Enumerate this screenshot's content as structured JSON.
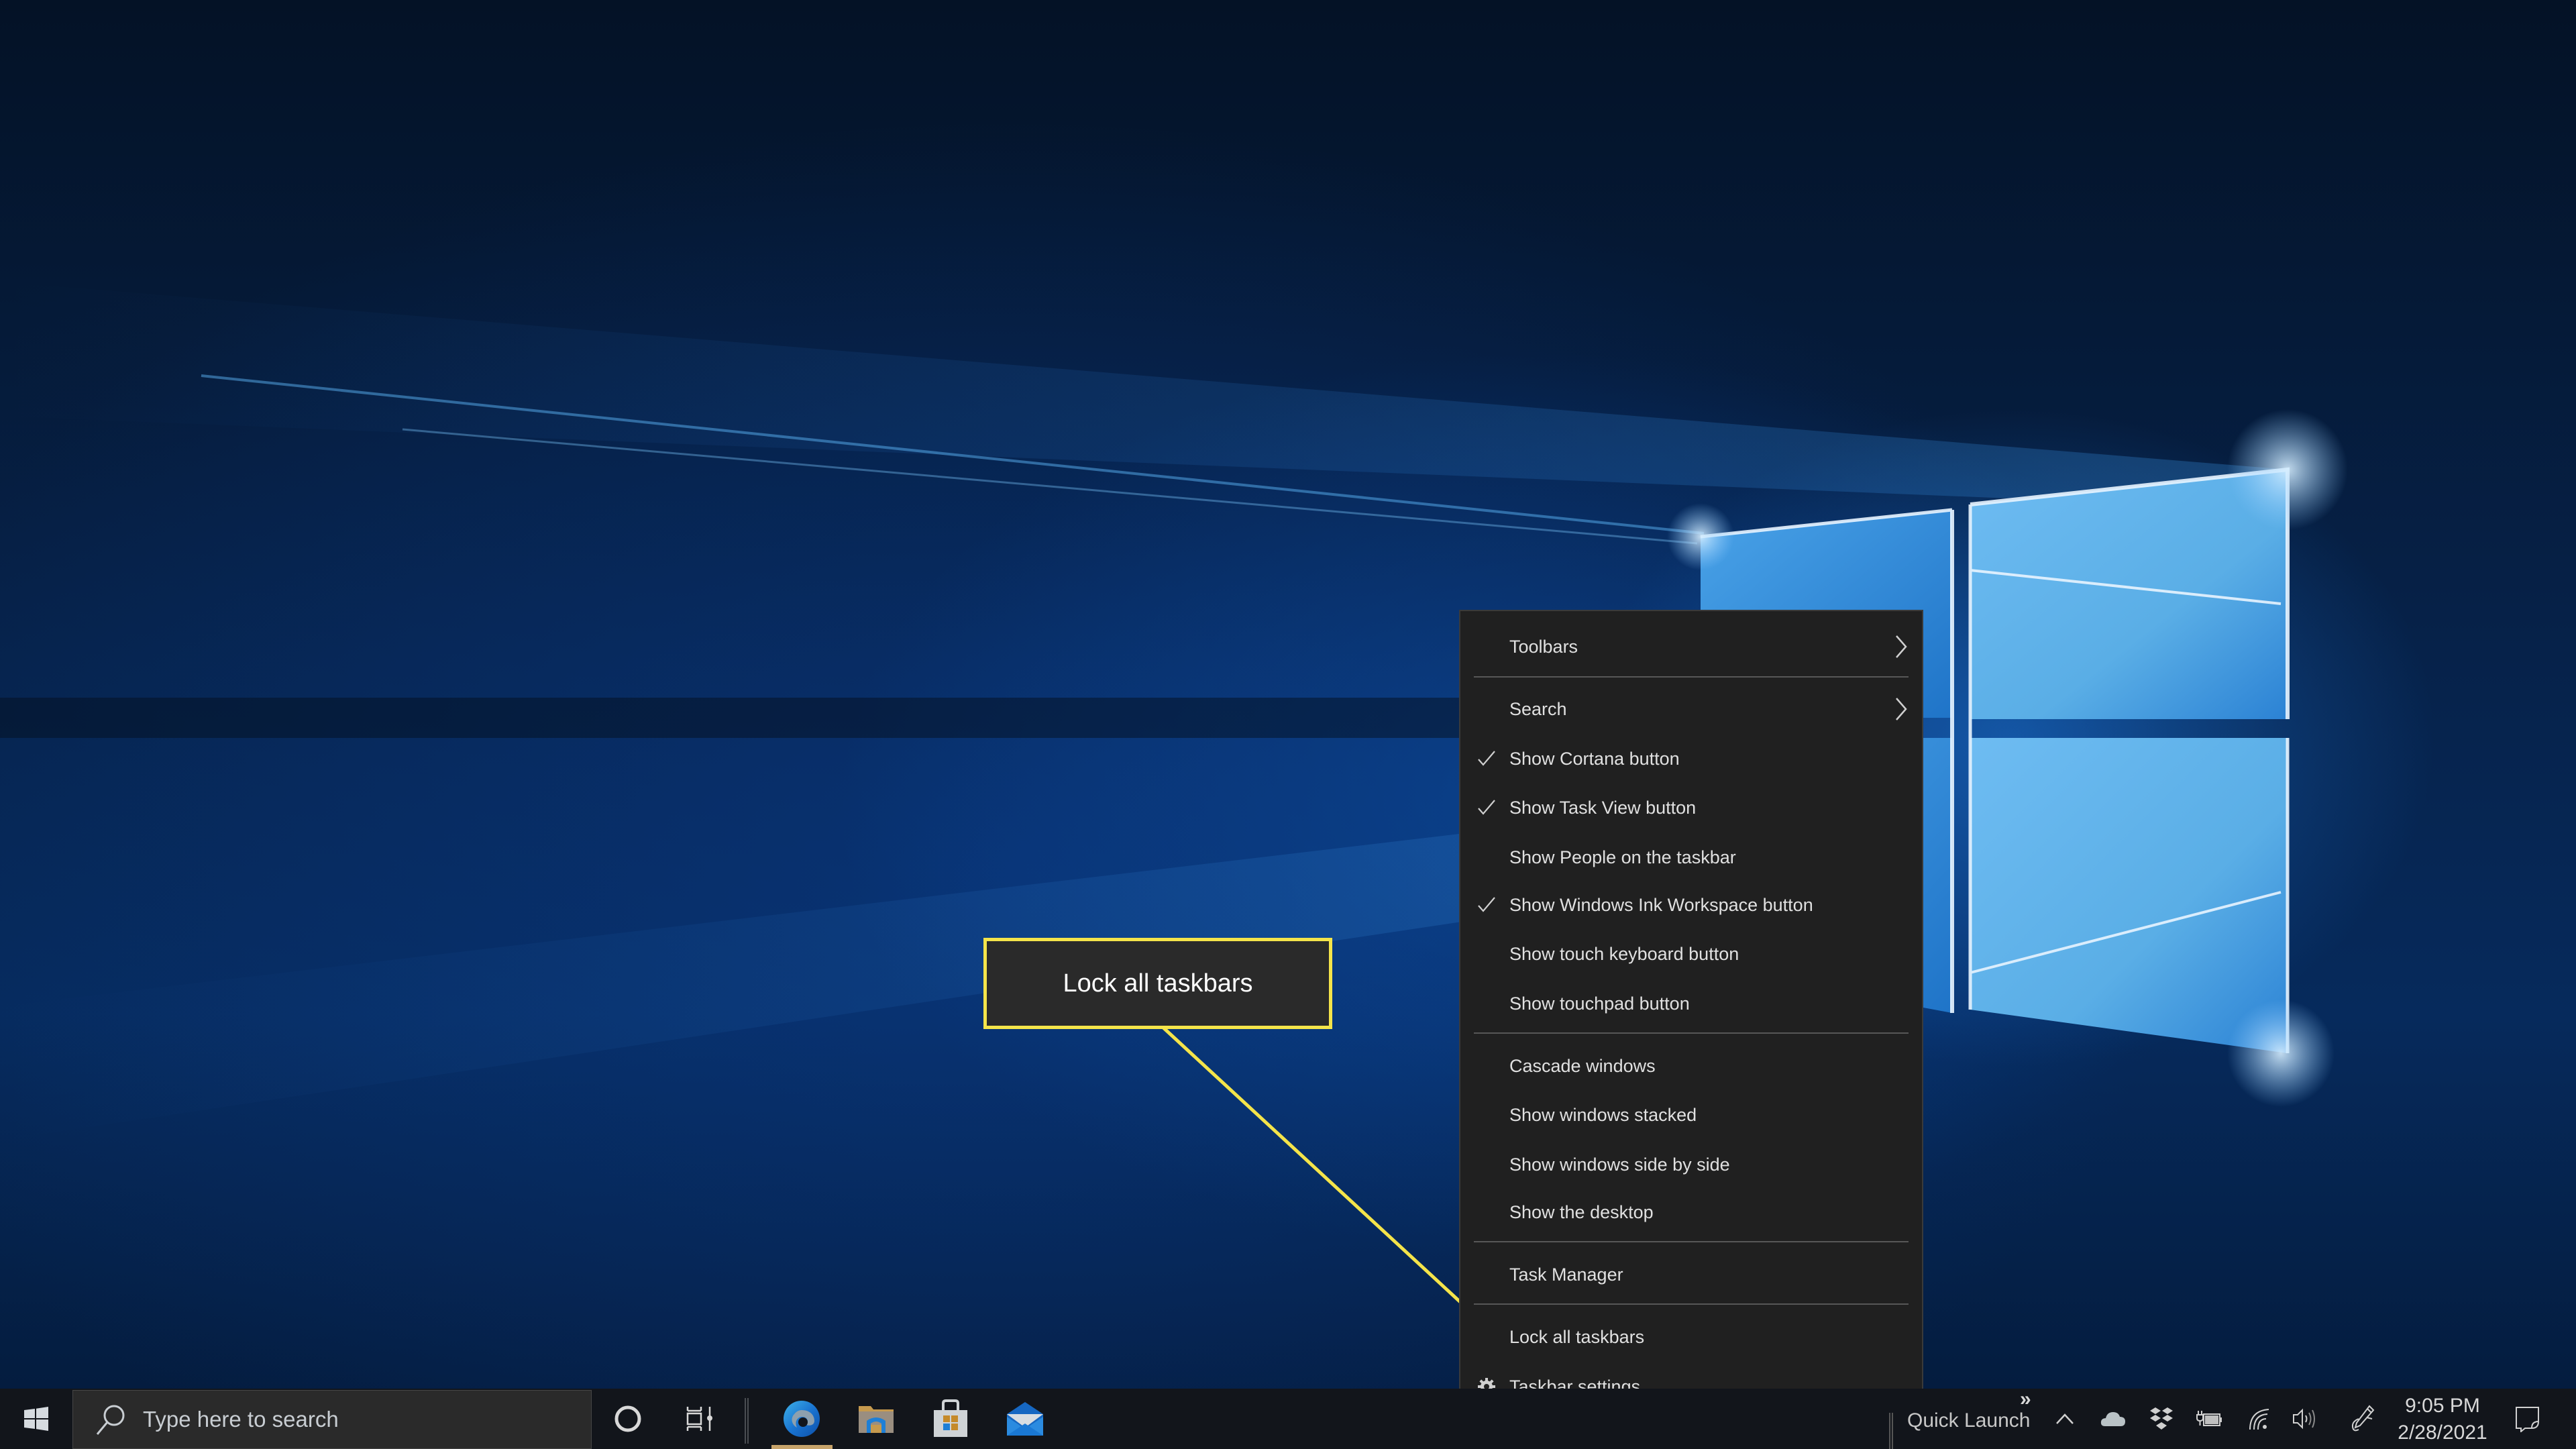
{
  "desktop": {
    "wallpaper": "windows-10-hero-light",
    "colors": {
      "wallpaper_dark": "#041226",
      "wallpaper_light": "#5fb4f0",
      "callout_yellow": "#f4e44a"
    }
  },
  "callout": {
    "label": "Lock all taskbars"
  },
  "context_menu": {
    "items": [
      {
        "label": "Toolbars",
        "checked": false,
        "submenu": true
      },
      {
        "label": "Search",
        "checked": false,
        "submenu": true
      },
      {
        "label": "Show Cortana button",
        "checked": true,
        "submenu": false
      },
      {
        "label": "Show Task View button",
        "checked": true,
        "submenu": false
      },
      {
        "label": "Show People on the taskbar",
        "checked": false,
        "submenu": false
      },
      {
        "label": "Show Windows Ink Workspace button",
        "checked": true,
        "submenu": false
      },
      {
        "label": "Show touch keyboard button",
        "checked": false,
        "submenu": false
      },
      {
        "label": "Show touchpad button",
        "checked": false,
        "submenu": false
      },
      {
        "label": "Cascade windows",
        "checked": false,
        "submenu": false
      },
      {
        "label": "Show windows stacked",
        "checked": false,
        "submenu": false
      },
      {
        "label": "Show windows side by side",
        "checked": false,
        "submenu": false
      },
      {
        "label": "Show the desktop",
        "checked": false,
        "submenu": false
      },
      {
        "label": "Task Manager",
        "checked": false,
        "submenu": false
      },
      {
        "label": "Lock all taskbars",
        "checked": false,
        "submenu": false
      },
      {
        "label": "Taskbar settings",
        "checked": false,
        "submenu": false,
        "icon": "gear-icon"
      }
    ]
  },
  "taskbar": {
    "start_icon": "windows-logo-icon",
    "search": {
      "placeholder": "Type here to search",
      "value": ""
    },
    "cortana_icon": "cortana-ring-icon",
    "taskview_icon": "task-view-icon",
    "pinned_apps": [
      {
        "name": "Microsoft Edge",
        "icon": "edge-icon",
        "active": true
      },
      {
        "name": "File Explorer",
        "icon": "folder-icon",
        "active": false
      },
      {
        "name": "Microsoft Store",
        "icon": "store-bag-icon",
        "active": false
      },
      {
        "name": "Mail",
        "icon": "mail-icon",
        "active": false
      }
    ],
    "quick_launch": {
      "label": "Quick Launch",
      "chevron": "»"
    },
    "tray": {
      "icons": [
        "chevron-up-icon",
        "onedrive-icon",
        "dropbox-icon",
        "battery-charging-icon",
        "wifi-icon",
        "volume-icon",
        "windows-ink-icon"
      ]
    },
    "clock": {
      "time": "9:05 PM",
      "date": "2/28/2021"
    },
    "notifications_icon": "action-center-icon"
  }
}
